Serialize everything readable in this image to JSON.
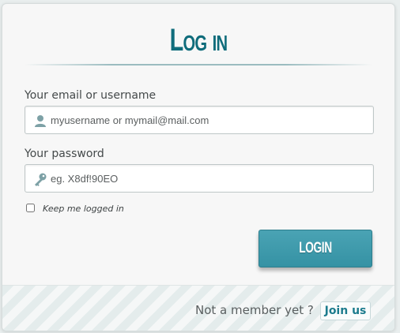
{
  "form": {
    "title": "Log in",
    "username": {
      "label": "Your email or username",
      "placeholder": "myusername or mymail@mail.com",
      "value": "",
      "icon": "user-icon"
    },
    "password": {
      "label": "Your password",
      "placeholder": "eg. X8df!90EO",
      "value": "",
      "icon": "key-icon"
    },
    "keep_logged_in": {
      "label": "Keep me logged in",
      "checked": false
    },
    "submit_label": "LOGIN"
  },
  "footer": {
    "prompt": "Not a member yet ?",
    "join_label": "Join us"
  },
  "colors": {
    "accent": "#0f6c7b",
    "button": "#3d9aac",
    "link": "#1c7b8d"
  }
}
